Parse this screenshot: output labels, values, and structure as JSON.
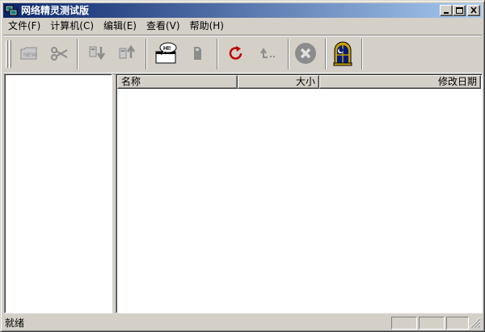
{
  "window": {
    "title": "网络精灵测试版"
  },
  "menu": [
    {
      "label": "文件(F)"
    },
    {
      "label": "计算机(C)"
    },
    {
      "label": "编辑(E)"
    },
    {
      "label": "查看(V)"
    },
    {
      "label": "帮助(H)"
    }
  ],
  "toolbar": {
    "icons": [
      "new-icon",
      "cut-icon",
      "download-icon",
      "upload-icon",
      "chat-icon",
      "file-icon",
      "refresh-icon",
      "parent-folder-icon",
      "stop-icon",
      "night-window-icon"
    ]
  },
  "list": {
    "columns": [
      {
        "label": "名称"
      },
      {
        "label": "大小"
      },
      {
        "label": "修改日期"
      }
    ]
  },
  "status": {
    "text": "就绪"
  },
  "colors": {
    "title_start": "#0a246a",
    "title_end": "#a6caf0",
    "face": "#d4d0c8",
    "refresh": "#c00000",
    "stop": "#808080"
  }
}
